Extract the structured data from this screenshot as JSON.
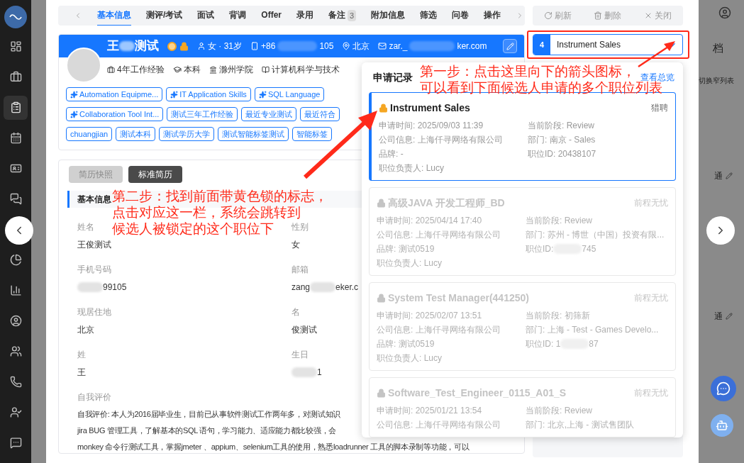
{
  "sidebar": {
    "items": [
      {
        "selected": false
      },
      {
        "selected": false
      },
      {
        "selected": true
      },
      {
        "selected": false
      },
      {
        "selected": false
      },
      {
        "selected": false
      },
      {
        "selected": false
      },
      {
        "selected": false
      },
      {
        "selected": false
      },
      {
        "selected": false
      },
      {
        "selected": false
      },
      {
        "selected": false
      },
      {
        "selected": false
      }
    ]
  },
  "background_page": {
    "title_fragment": "档",
    "toggle_link": "切换窄列表",
    "field_values": [
      "通",
      "通"
    ]
  },
  "modal": {
    "tabs": [
      {
        "label": "基本信息",
        "selected": true
      },
      {
        "label": "测评/考试",
        "selected": false
      },
      {
        "label": "面试",
        "selected": false
      },
      {
        "label": "背调",
        "selected": false
      },
      {
        "label": "Offer",
        "selected": false
      },
      {
        "label": "录用",
        "selected": false
      },
      {
        "label": "备注",
        "selected": false,
        "badge": "3"
      },
      {
        "label": "附加信息",
        "selected": false
      },
      {
        "label": "筛选",
        "selected": false
      },
      {
        "label": "问卷",
        "selected": false
      },
      {
        "label": "操作",
        "selected": false
      }
    ],
    "toolbar": [
      {
        "label": "刷新",
        "kind": "refresh"
      },
      {
        "label": "删除",
        "kind": "delete"
      },
      {
        "label": "关闭",
        "kind": "close"
      }
    ],
    "profile": {
      "name": [
        "王",
        "测试"
      ],
      "gender_age": "女 · 31岁",
      "phone": [
        "+86",
        "105"
      ],
      "city": "北京",
      "email": [
        "zar._",
        "ker.com"
      ],
      "experience": "4年工作经验",
      "degree": "本科",
      "school": "滁州学院",
      "major": "计算机科学与技术",
      "tag_rows": [
        [
          {
            "label": "Automation Equipme...",
            "kind": "ai"
          },
          {
            "label": "IT Application Skills",
            "kind": "ai"
          },
          {
            "label": "SQL Language",
            "kind": "ai"
          }
        ],
        [
          {
            "label": "Collaboration Tool Int...",
            "kind": "ai"
          },
          {
            "label": "测试三年工作经验",
            "kind": "plain"
          },
          {
            "label": "最近专业测试",
            "kind": "plain"
          },
          {
            "label": "最近符合",
            "kind": "plain"
          }
        ],
        [
          {
            "label": "chuangjian",
            "kind": "plain"
          },
          {
            "label": "测试本科",
            "kind": "plain"
          },
          {
            "label": "测试学历大学",
            "kind": "plain"
          },
          {
            "label": "测试智能标签测试",
            "kind": "plain"
          },
          {
            "label": "智能标签",
            "kind": "plain"
          }
        ]
      ]
    },
    "resume": {
      "views": [
        {
          "label": "简历快照",
          "selected": false
        },
        {
          "label": "标准简历",
          "selected": true
        }
      ],
      "section": "基本信息",
      "fields": [
        {
          "label": "姓名",
          "value": [
            "王俊测试"
          ],
          "masked_prefix": false
        },
        {
          "label": "性别",
          "value": [
            "女"
          ],
          "masked_prefix": false
        },
        {
          "label": "手机号码",
          "value": [
            "99105"
          ],
          "masked_prefix": true
        },
        {
          "label": "邮箱",
          "value": [
            "zang",
            "eker.c"
          ],
          "masked_prefix": false
        },
        {
          "label": "现居住地",
          "value": [
            "北京"
          ],
          "masked_prefix": false
        },
        {
          "label": "名",
          "value": [
            "俊测试"
          ],
          "masked_prefix": false
        },
        {
          "label": "姓",
          "value": [
            "王"
          ],
          "masked_prefix": false
        },
        {
          "label": "生日",
          "value": [
            "1"
          ],
          "masked_prefix": true
        }
      ],
      "self_eval": {
        "label": "自我评价",
        "lines": [
          "自我评价: 本人为2016届毕业生，目前已从事软件测试工作两年多，对测试知识",
          "jira BUG 管理工具，了解基本的SQL 语句，学习能力、适应能力都比较强，会",
          "monkey 命令行测试工具，掌握jmeter 、appium、selenium工具的使用，熟悉loadrunner 工具的脚本录制等功能，可以"
        ]
      }
    },
    "job_select": {
      "count": "4",
      "value": "Instrument Sales"
    },
    "applications": {
      "title": "申请记录",
      "overview_link": "查看总览",
      "items": [
        {
          "title": "Instrument Sales",
          "source": "猎聘",
          "selected": true,
          "locked": true,
          "disabled": false,
          "cells": [
            [
              "申请时间: 2025/09/03 11:39"
            ],
            [
              "当前阶段: Review"
            ],
            [
              "公司信息: 上海仟寻网络有限公司"
            ],
            [
              "部门: 南京 - Sales"
            ],
            [
              "品牌: -"
            ],
            [
              "职位ID: 20438107"
            ],
            [
              "职位负责人: Lucy"
            ]
          ]
        },
        {
          "title": "高级JAVA 开发工程师_BD",
          "source": "前程无忧",
          "selected": false,
          "locked": true,
          "disabled": true,
          "cells": [
            [
              "申请时间: 2025/04/14 17:40"
            ],
            [
              "当前阶段: Review"
            ],
            [
              "公司信息: 上海仟寻网络有限公司"
            ],
            [
              "部门: 苏州 - 博世（中国）投资有限..."
            ],
            [
              "品牌: 测试0519"
            ],
            [
              "职位ID:",
              "745"
            ],
            [
              "职位负责人: Lucy"
            ]
          ]
        },
        {
          "title": "System Test Manager(441250)",
          "source": "前程无忧",
          "selected": false,
          "locked": true,
          "disabled": true,
          "cells": [
            [
              "申请时间: 2025/02/07 13:51"
            ],
            [
              "当前阶段: 初筛新"
            ],
            [
              "公司信息: 上海仟寻网络有限公司"
            ],
            [
              "部门: 上海 - Test - Games Develo..."
            ],
            [
              "品牌: 测试0519"
            ],
            [
              "职位ID: 1",
              "87"
            ],
            [
              "职位负责人: Lucy"
            ]
          ]
        },
        {
          "title": "Software_Test_Engineer_0115_A01_S",
          "source": "前程无忧",
          "selected": false,
          "locked": true,
          "disabled": true,
          "cells": [
            [
              "申请时间: 2025/01/21 13:54"
            ],
            [
              "当前阶段: Review"
            ],
            [
              "公司信息: 上海仟寻网络有限公司"
            ],
            [
              "部门: 北京,上海 - 测试售团队"
            ]
          ]
        }
      ]
    }
  },
  "annotations": [
    {
      "kind": "step",
      "lines": [
        "第一步：点击这里向下的箭头图标，",
        "可以看到下面候选人申请的多个职位列表"
      ]
    },
    {
      "kind": "step",
      "lines": [
        "第二步：找到前面带黄色锁的标志，",
        "点击对应这一栏，系统会跳转到",
        "候选人被锁定的这个职位下"
      ]
    }
  ]
}
